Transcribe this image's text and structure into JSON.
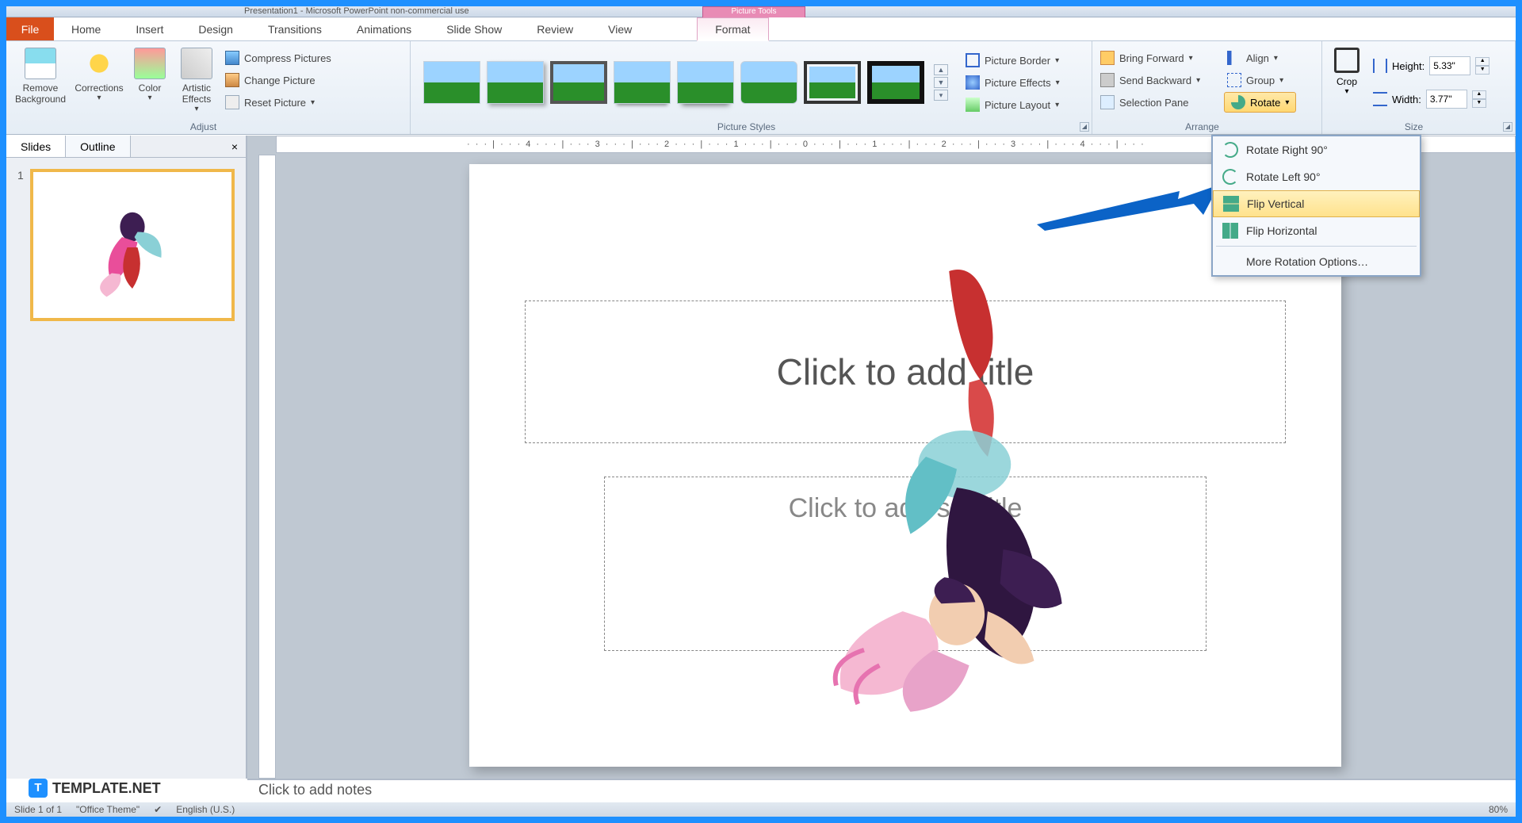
{
  "title_bar": "Presentation1 - Microsoft PowerPoint non-commercial use",
  "picture_tools": "Picture Tools",
  "tabs": {
    "file": "File",
    "home": "Home",
    "insert": "Insert",
    "design": "Design",
    "transitions": "Transitions",
    "animations": "Animations",
    "slideshow": "Slide Show",
    "review": "Review",
    "view": "View",
    "format": "Format"
  },
  "ribbon": {
    "remove_bg": "Remove\nBackground",
    "corrections": "Corrections",
    "color": "Color",
    "artistic": "Artistic\nEffects",
    "compress": "Compress Pictures",
    "change": "Change Picture",
    "reset": "Reset Picture",
    "adjust_group": "Adjust",
    "styles_group": "Picture Styles",
    "border": "Picture Border",
    "effects": "Picture Effects",
    "layout": "Picture Layout",
    "bring_fwd": "Bring Forward",
    "send_back": "Send Backward",
    "sel_pane": "Selection Pane",
    "align": "Align",
    "group": "Group",
    "rotate": "Rotate",
    "arrange_group": "Arrange",
    "crop": "Crop",
    "height_lbl": "Height:",
    "width_lbl": "Width:",
    "height_val": "5.33\"",
    "width_val": "3.77\"",
    "size_group": "Size"
  },
  "rotate_menu": {
    "rr90": "Rotate Right 90°",
    "rl90": "Rotate Left 90°",
    "flipv": "Flip Vertical",
    "fliph": "Flip Horizontal",
    "more": "More Rotation Options…"
  },
  "panel": {
    "slides": "Slides",
    "outline": "Outline",
    "slide_num": "1"
  },
  "slide": {
    "title_ph": "Click to add title",
    "sub_ph": "Click to add subtitle"
  },
  "notes": "Click to add notes",
  "status": {
    "slide": "Slide 1 of 1",
    "theme": "\"Office Theme\"",
    "lang": "English (U.S.)",
    "zoom": "80%"
  },
  "watermark": "TEMPLATE.NET",
  "ruler_h": "· · · | · · · 4 · · · | · · · 3 · · · | · · · 2 · · · | · · · 1 · · · | · · · 0 · · · | · · · 1 · · · | · · · 2 · · · | · · · 3 · · · | · · · 4 · · · | · · ·"
}
